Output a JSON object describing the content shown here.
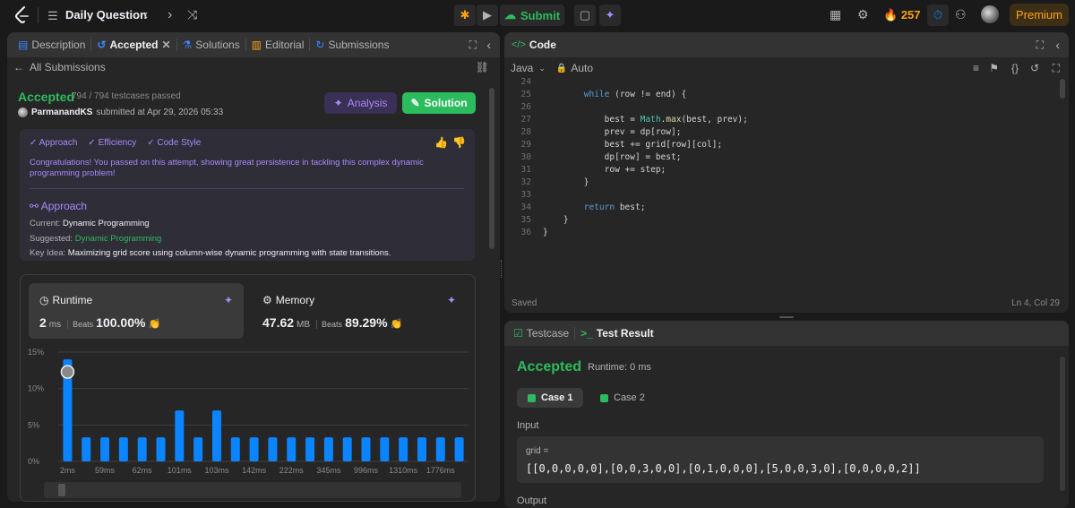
{
  "topbar": {
    "title": "Daily Question",
    "submit_label": "Submit",
    "streak": "257",
    "premium_label": "Premium"
  },
  "left_panel": {
    "tabs": [
      {
        "label": "Description"
      },
      {
        "label": "Accepted"
      },
      {
        "label": "Solutions"
      },
      {
        "label": "Editorial"
      },
      {
        "label": "Submissions"
      }
    ],
    "back_label": "All Submissions",
    "status": "Accepted",
    "tests_passed": "794 / 794 testcases passed",
    "author": "ParmanandKS",
    "submitted_text": "submitted at Apr 29, 2026 05:33",
    "analysis_label": "Analysis",
    "solution_label": "Solution",
    "feedback": {
      "tags": [
        "Approach",
        "Efficiency",
        "Code Style"
      ],
      "message": "Congratulations! You passed on this attempt, showing great persistence in tackling this complex dynamic programming problem!",
      "approach_title": "Approach",
      "current_key": "Current:",
      "current_value": "Dynamic Programming",
      "suggested_key": "Suggested:",
      "suggested_value": "Dynamic Programming",
      "key_idea_key": "Key Idea:",
      "key_idea_value": "Maximizing grid score using column-wise dynamic programming with state transitions."
    },
    "runtime": {
      "title": "Runtime",
      "value": "2",
      "unit": "ms",
      "beats_label": "Beats",
      "beats": "100.00%"
    },
    "memory": {
      "title": "Memory",
      "value": "47.62",
      "unit": "MB",
      "beats_label": "Beats",
      "beats": "89.29%"
    }
  },
  "chart_data": {
    "type": "bar",
    "categories": [
      "2ms",
      "",
      "59ms",
      "",
      "62ms",
      "",
      "101ms",
      "",
      "103ms",
      "",
      "142ms",
      "",
      "222ms",
      "",
      "345ms",
      "",
      "996ms",
      "",
      "1310ms",
      "",
      "1776ms",
      ""
    ],
    "values": [
      14,
      3.3,
      3.3,
      3.3,
      3.3,
      3.3,
      7,
      3.3,
      7,
      3.3,
      3.3,
      3.3,
      3.3,
      3.3,
      3.3,
      3.3,
      3.3,
      3.3,
      3.3,
      3.3,
      3.3,
      3.3
    ],
    "x_tick_labels": [
      "2ms",
      "59ms",
      "62ms",
      "101ms",
      "103ms",
      "142ms",
      "222ms",
      "345ms",
      "996ms",
      "1310ms",
      "1776ms"
    ],
    "y_tick_labels": [
      "0%",
      "5%",
      "10%",
      "15%"
    ],
    "ylim": [
      0,
      15
    ],
    "bar_color": "#0a84ff",
    "grid": true
  },
  "code_panel": {
    "title": "Code",
    "language": "Java",
    "mode": "Auto",
    "lines": [
      {
        "n": "24",
        "t": ""
      },
      {
        "n": "25",
        "t": "        while (row != end) {"
      },
      {
        "n": "26",
        "t": ""
      },
      {
        "n": "27",
        "t": "            best = Math.max(best, prev);"
      },
      {
        "n": "28",
        "t": "            prev = dp[row];"
      },
      {
        "n": "29",
        "t": "            best += grid[row][col];"
      },
      {
        "n": "30",
        "t": "            dp[row] = best;"
      },
      {
        "n": "31",
        "t": "            row += step;"
      },
      {
        "n": "32",
        "t": "        }"
      },
      {
        "n": "33",
        "t": ""
      },
      {
        "n": "34",
        "t": "        return best;"
      },
      {
        "n": "35",
        "t": "    }"
      },
      {
        "n": "36",
        "t": "}"
      }
    ],
    "saved": "Saved",
    "cursor": "Ln 4, Col 29"
  },
  "result_panel": {
    "tab_testcase": "Testcase",
    "tab_result": "Test Result",
    "status": "Accepted",
    "runtime": "Runtime: 0 ms",
    "case1": "Case 1",
    "case2": "Case 2",
    "input_label": "Input",
    "input_var": "grid =",
    "input_value": "[[0,0,0,0,0],[0,0,3,0,0],[0,1,0,0,0],[5,0,0,3,0],[0,0,0,0,2]]",
    "output_label": "Output"
  },
  "colors": {
    "accepted": "#2cbb5d",
    "accent": "#ffa116",
    "ai": "#a78bfa"
  }
}
